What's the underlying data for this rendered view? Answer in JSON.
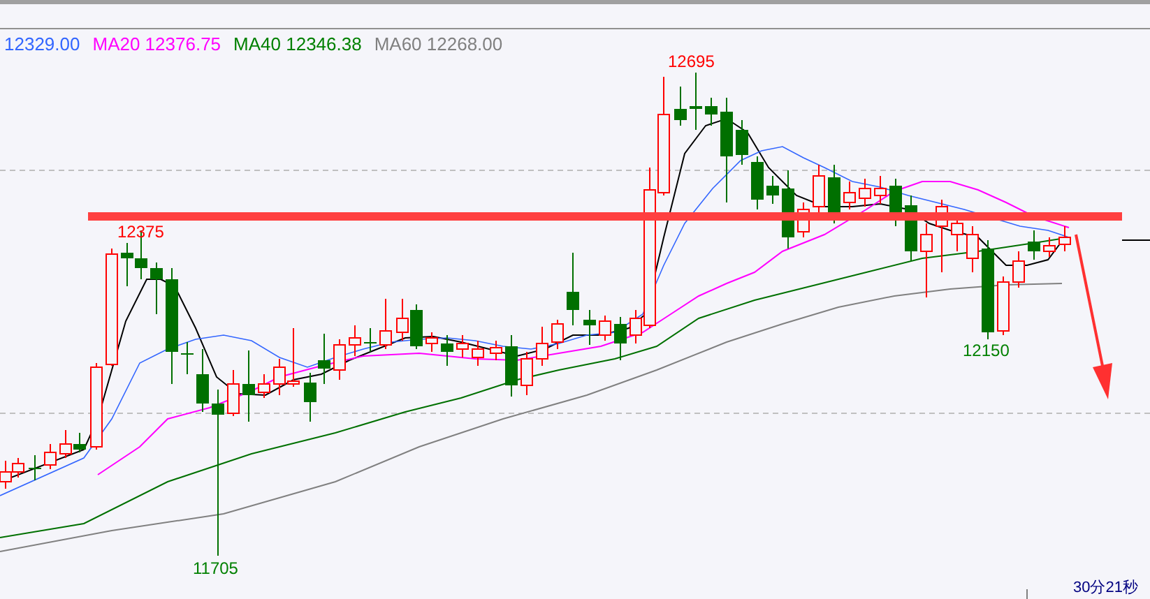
{
  "legend": [
    {
      "text": "12329.00",
      "color": "#3366ff"
    },
    {
      "text": "MA20 12376.75",
      "color": "#ff00ff"
    },
    {
      "text": "MA40 12346.38",
      "color": "#008000"
    },
    {
      "text": "MA60 12268.00",
      "color": "#808080"
    }
  ],
  "price_labels": [
    {
      "text": "12695",
      "color": "#ff0000"
    },
    {
      "text": "12375",
      "color": "#ff0000"
    },
    {
      "text": "12150",
      "color": "#008000"
    },
    {
      "text": "11705",
      "color": "#008000"
    }
  ],
  "footer": {
    "text": "30分21秒"
  }
}
